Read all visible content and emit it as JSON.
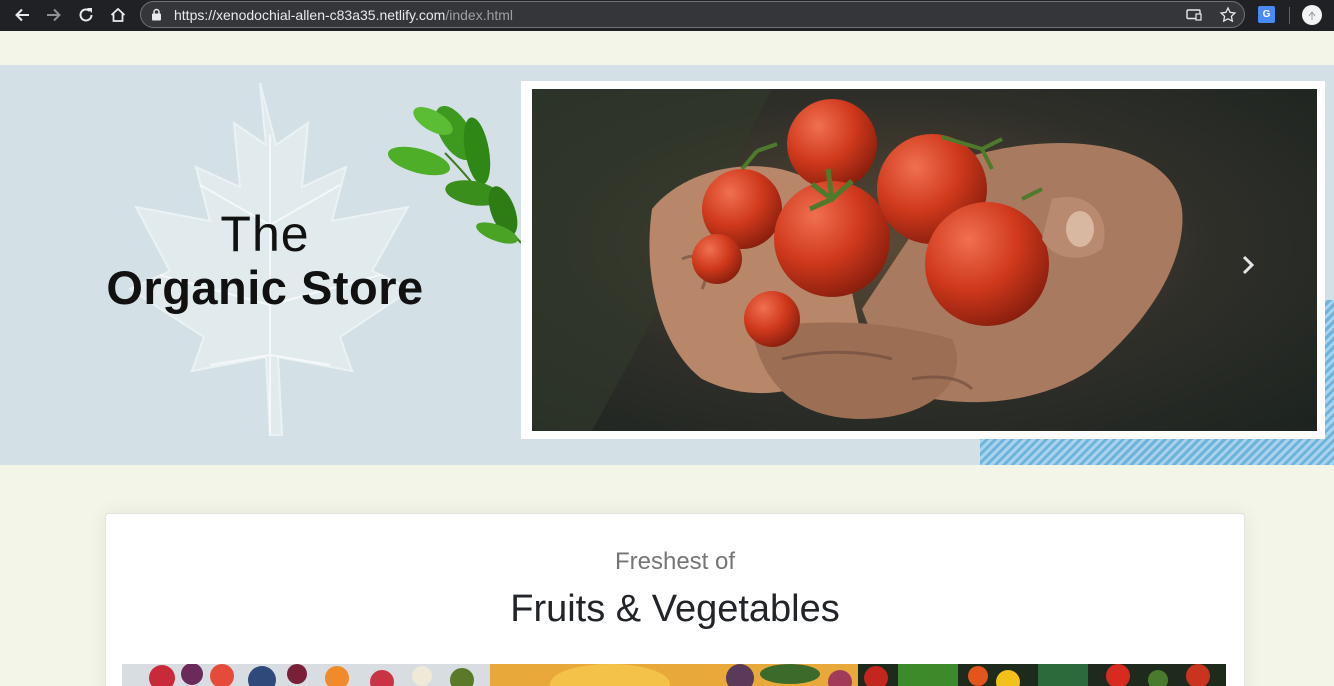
{
  "browser": {
    "url_host": "https://xenodochial-allen-c83a35.netlify.com",
    "url_path": "/index.html",
    "icons": [
      "back-icon",
      "forward-icon",
      "reload-icon",
      "home-icon",
      "lock-icon",
      "cast-icon",
      "star-icon",
      "translate-extension-icon",
      "profile-icon"
    ],
    "chrome_color": "#202124"
  },
  "hero": {
    "title_line1": "The",
    "title_line2": "Organic Store",
    "background": "#d3e1e6",
    "carousel_next_icon": "chevron-right-icon",
    "slide_image": "hands-holding-tomatoes"
  },
  "intro": {
    "subtitle": "Freshest of",
    "title": "Fruits & Vegetables"
  },
  "gallery": {
    "images": [
      "fruit-bowls-photo",
      "produce-basket-photo",
      "vegetables-market-photo"
    ]
  },
  "colors": {
    "page_background": "#f2f5e8",
    "accent_stripes": "#6db3db"
  }
}
